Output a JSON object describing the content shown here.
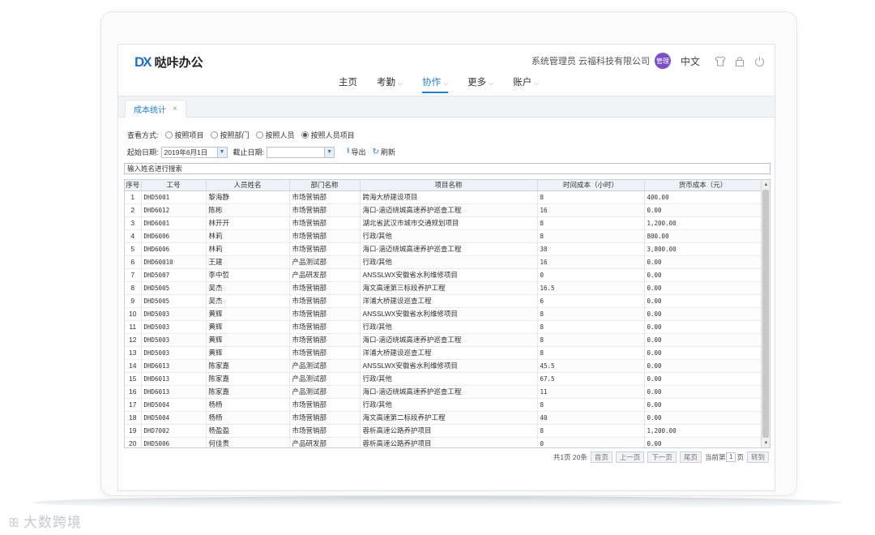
{
  "app": {
    "logo_mark": "DX",
    "logo_text": "哒咔办公"
  },
  "header": {
    "user_info": "系统管理员 云福科技有限公司",
    "avatar_label": "管理",
    "lang": "中文"
  },
  "nav": [
    {
      "label": "主页",
      "chev": ""
    },
    {
      "label": "考勤",
      "chev": "⌵"
    },
    {
      "label": "协作",
      "chev": "⌵"
    },
    {
      "label": "更多",
      "chev": "⌵"
    },
    {
      "label": "账户",
      "chev": "⌵"
    }
  ],
  "nav_active": "协作",
  "tab": {
    "label": "成本统计",
    "close": "×"
  },
  "view_mode": {
    "label": "查看方式:",
    "options": [
      "按照项目",
      "按照部门",
      "按照人员",
      "按照人员项目"
    ],
    "selected": "按照人员项目"
  },
  "filter": {
    "start_label": "起始日期:",
    "start_value": "2019年6月1日",
    "end_label": "截止日期:",
    "end_value": "",
    "export_label": "导出",
    "refresh_label": "刷新"
  },
  "search": {
    "placeholder": "输入姓名进行搜索"
  },
  "table": {
    "columns": [
      "序号",
      "工号",
      "人员姓名",
      "部门名称",
      "项目名称",
      "时间成本（小时）",
      "货币成本（元）"
    ],
    "rows": [
      [
        "1",
        "DHD5001",
        "黎海静",
        "市场营销部",
        "跨海大桥建设项目",
        "8",
        "400.00"
      ],
      [
        "2",
        "DHD6012",
        "陈彬",
        "市场营销部",
        "海口-涵迈绕城高速养护巡查工程",
        "16",
        "0.00"
      ],
      [
        "3",
        "DHD6001",
        "林开开",
        "市场营销部",
        "湖北省武汉市城市交通规划项目",
        "8",
        "1,200.00"
      ],
      [
        "4",
        "DHD6006",
        "林莉",
        "市场营销部",
        "行政/其他",
        "8",
        "800.00"
      ],
      [
        "5",
        "DHD6006",
        "林莉",
        "市场营销部",
        "海口-涵迈绕城高速养护巡查工程",
        "38",
        "3,800.00"
      ],
      [
        "6",
        "DHD60010",
        "王建",
        "产品测试部",
        "行政/其他",
        "16",
        "0.00"
      ],
      [
        "7",
        "DHD5007",
        "李中哲",
        "产品研发部",
        "ANSSLWX安徽省水利维修项目",
        "0",
        "0.00"
      ],
      [
        "8",
        "DHD5005",
        "吴杰",
        "市场营销部",
        "海文高速第三标段养护工程",
        "16.5",
        "0.00"
      ],
      [
        "9",
        "DHD5005",
        "吴杰",
        "市场营销部",
        "洋浦大桥建设巡查工程",
        "6",
        "0.00"
      ],
      [
        "10",
        "DHD5003",
        "黄辉",
        "市场营销部",
        "ANSSLWX安徽省水利维修项目",
        "8",
        "0.00"
      ],
      [
        "11",
        "DHD5003",
        "黄辉",
        "市场营销部",
        "行政/其他",
        "8",
        "0.00"
      ],
      [
        "12",
        "DHD5003",
        "黄辉",
        "市场营销部",
        "海口-涵迈绕城高速养护巡查工程",
        "8",
        "0.00"
      ],
      [
        "13",
        "DHD5003",
        "黄辉",
        "市场营销部",
        "洋浦大桥建设巡查工程",
        "8",
        "0.00"
      ],
      [
        "14",
        "DHD6013",
        "陈家嘉",
        "产品测试部",
        "ANSSLWX安徽省水利维修项目",
        "45.5",
        "0.00"
      ],
      [
        "15",
        "DHD6013",
        "陈家嘉",
        "产品测试部",
        "行政/其他",
        "67.5",
        "0.00"
      ],
      [
        "16",
        "DHD6013",
        "陈家嘉",
        "产品测试部",
        "海口-涵迈绕城高速养护巡查工程",
        "11",
        "0.00"
      ],
      [
        "17",
        "DHD5004",
        "杨杨",
        "市场营销部",
        "行政/其他",
        "8",
        "0.00"
      ],
      [
        "18",
        "DHD5004",
        "杨杨",
        "市场营销部",
        "海文高速第二标段养护工程",
        "40",
        "0.00"
      ],
      [
        "19",
        "DHD7002",
        "杨盈盈",
        "市场营销部",
        "蓉析高速公路养护项目",
        "8",
        "1,200.00"
      ],
      [
        "20",
        "DHD5006",
        "何佳贵",
        "产品研发部",
        "蓉析高速公路养护项目",
        "0",
        "0.00"
      ]
    ]
  },
  "pager": {
    "summary": "共1页 20条",
    "first": "首页",
    "prev": "上一页",
    "next": "下一页",
    "last": "尾页",
    "current_label_pre": "当前第",
    "current_value": "1",
    "current_label_post": "页",
    "go": "转到"
  },
  "watermark": {
    "mark": "ꕥ",
    "text": "大数跨境"
  }
}
